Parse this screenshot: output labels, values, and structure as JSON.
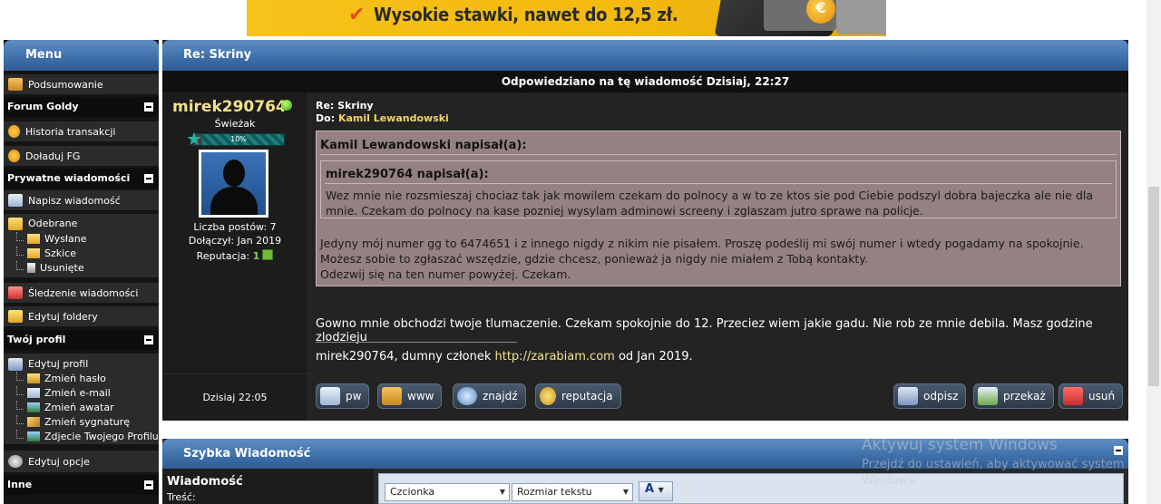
{
  "banner": {
    "text": "Wysokie stawki, nawet do 12,5 zł."
  },
  "sidebar": {
    "title": "Menu",
    "summary": "Podsumowanie",
    "cat_goldy": "Forum Goldy",
    "transactions": "Historia transakcji",
    "topup": "Doładuj FG",
    "cat_pm": "Prywatne wiadomości",
    "write": "Napisz wiadomość",
    "inbox": "Odebrane",
    "sent": "Wysłane",
    "drafts": "Szkice",
    "deleted": "Usunięte",
    "tracking": "Śledzenie wiadomości",
    "folders": "Edytuj foldery",
    "cat_profile": "Twój profil",
    "edit_profile": "Edytuj profil",
    "change_password": "Zmień hasło",
    "change_email": "Zmień e-mail",
    "change_avatar": "Zmień awatar",
    "change_signature": "Zmień sygnaturę",
    "profile_photo": "Zdjecie Twojego Profilu",
    "edit_options": "Edytuj opcje",
    "cat_other": "Inne"
  },
  "post": {
    "header": "Re: Skriny",
    "reply_bar": "Odpowiedziano na tę wiadomość Dzisiaj, 22:27",
    "author": {
      "username": "mirek290764",
      "rank": "Świeżak",
      "progress_label": "10%",
      "progress": 0.1,
      "posts": "Liczba postów: 7",
      "joined": "Dołączył: Jan 2019",
      "rep_label": "Reputacja:",
      "rep_value": "1"
    },
    "title": "Re: Skriny",
    "to_label": "Do:",
    "to_name": "Kamil Lewandowski",
    "quote_outer_head": "Kamil Lewandowski napisał(a):",
    "quote_inner_head": "mirek290764 napisał(a):",
    "quote_inner_text": "Wez mnie nie rozsmieszaj chociaz tak jak mowilem czekam do polnocy a w to ze ktos sie pod Ciebie podszyl dobra bajeczka ale nie dla mnie. Czekam do polnocy na kase pozniej wysylam adminowi screeny i zglaszam jutro sprawe na policje.",
    "quote_outer_text_1": "Jedyny mój numer gg to 6474651 i z innego nigdy z nikim nie pisałem. Proszę podeślij mi swój numer i wtedy pogadamy na spokojnie.",
    "quote_outer_text_2": "Możesz sobie to zgłaszać wszędzie, gdzie chcesz, ponieważ ja nigdy nie miałem z Tobą kontakty.",
    "quote_outer_text_3": "Odezwij się na ten numer powyżej. Czekam.",
    "body": "Gowno mnie obchodzi twoje tlumaczenie. Czekam spokojnie do 12. Przeciez wiem jakie gadu. Nie rob ze mnie debila. Masz godzine zlodzieju",
    "sig_pre": "mirek290764, dumny członek ",
    "sig_link": "http://zarabiam.com",
    "sig_post": " od Jan 2019.",
    "date": "Dzisiaj 22:05",
    "buttons": {
      "pw": "pw",
      "www": "www",
      "find": "znajdź",
      "rep": "reputacja",
      "reply": "odpisz",
      "forward": "przekaż",
      "delete": "usuń"
    }
  },
  "quick": {
    "header": "Szybka Wiadomość",
    "label": "Wiadomość",
    "sublabel": "Treść:",
    "font": "Czcionka",
    "size": "Rozmiar tekstu",
    "color_btn": "A"
  },
  "watermark": {
    "title": "Aktywuj system Windows",
    "text": "Przejdź do ustawień, aby aktywować system Windows."
  }
}
